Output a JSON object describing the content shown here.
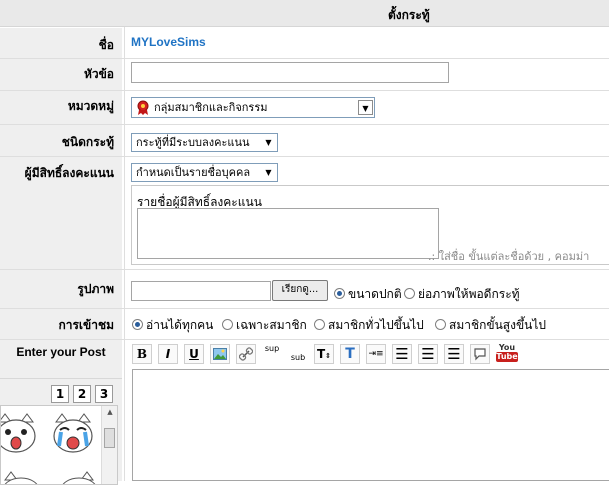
{
  "form_title": "ตั้งกระทู้",
  "name": {
    "label": "ชื่อ",
    "value": "MYLoveSims"
  },
  "subject": {
    "label": "หัวข้อ",
    "value": ""
  },
  "category": {
    "label": "หมวดหมู่",
    "selected": "กลุ่มสมาชิกและกิจกรรม",
    "icon": "members-group-icon"
  },
  "topic_type": {
    "label": "ชนิดกระทู้",
    "selected": "กระทู้ที่มีระบบลงคะแนน"
  },
  "voters": {
    "label": "ผู้มีสิทธิ์ลงคะแนน",
    "selected": "กำหนดเป็นรายชื่อบุคคล",
    "list_label": "รายชื่อผู้มีสิทธิ์ลงคะแนน",
    "hint": ".: ใส่ชื่อ ขั้นแต่ละชื่อด้วย , คอมม่า"
  },
  "image": {
    "label": "รูปภาพ",
    "browse_label": "เรียกดู...",
    "options": [
      "ขนาดปกติ",
      "ย่อภาพให้พอดีกระทู้"
    ],
    "selected": 0
  },
  "access": {
    "label": "การเข้าชม",
    "options": [
      "อ่านได้ทุกคน",
      "เฉพาะสมาชิก",
      "สมาชิกทั่วไปขึ้นไป",
      "สมาชิกขั้นสูงขึ้นไป"
    ],
    "selected": 0
  },
  "post": {
    "label": "Enter your Post",
    "toolbar": {
      "bold": "B",
      "italic": "I",
      "underline": "U",
      "sup": "sup",
      "sub": "sub",
      "text_size": "T",
      "text_color": "T",
      "youtube_top": "You",
      "youtube_bottom": "Tube"
    }
  },
  "emoticon_pages": [
    "1",
    "2",
    "3"
  ]
}
